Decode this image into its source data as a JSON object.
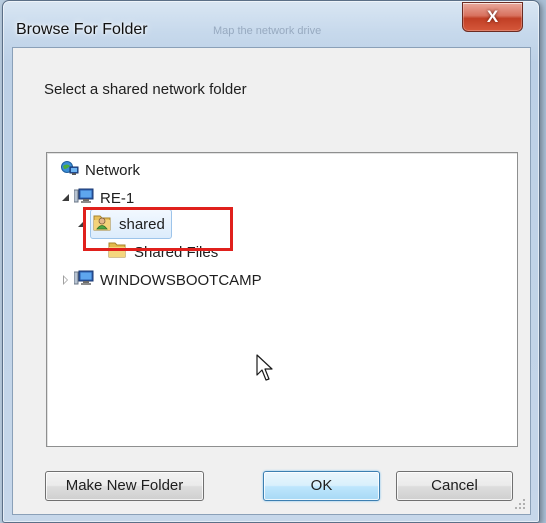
{
  "window": {
    "title": "Browse For Folder",
    "background_hint": "Map the network drive"
  },
  "close_glyph": "X",
  "instruction": "Select a shared network folder",
  "tree": {
    "root": {
      "label": "Network",
      "icon": "network-icon"
    },
    "nodes": [
      {
        "label": "RE-1",
        "icon": "computer-icon",
        "expanded": true
      },
      {
        "label": "shared",
        "icon": "user-folder-icon",
        "expanded": true,
        "selected": true
      },
      {
        "label": "Shared Files",
        "icon": "folder-icon"
      },
      {
        "label": "WINDOWSBOOTCAMP",
        "icon": "computer-icon",
        "expanded": false
      }
    ]
  },
  "buttons": {
    "make_new_folder": "Make New Folder",
    "ok": "OK",
    "cancel": "Cancel"
  },
  "colors": {
    "highlight_box": "#e0201c",
    "selection_fill": "#dcecfc",
    "close_button": "#c13f25"
  }
}
